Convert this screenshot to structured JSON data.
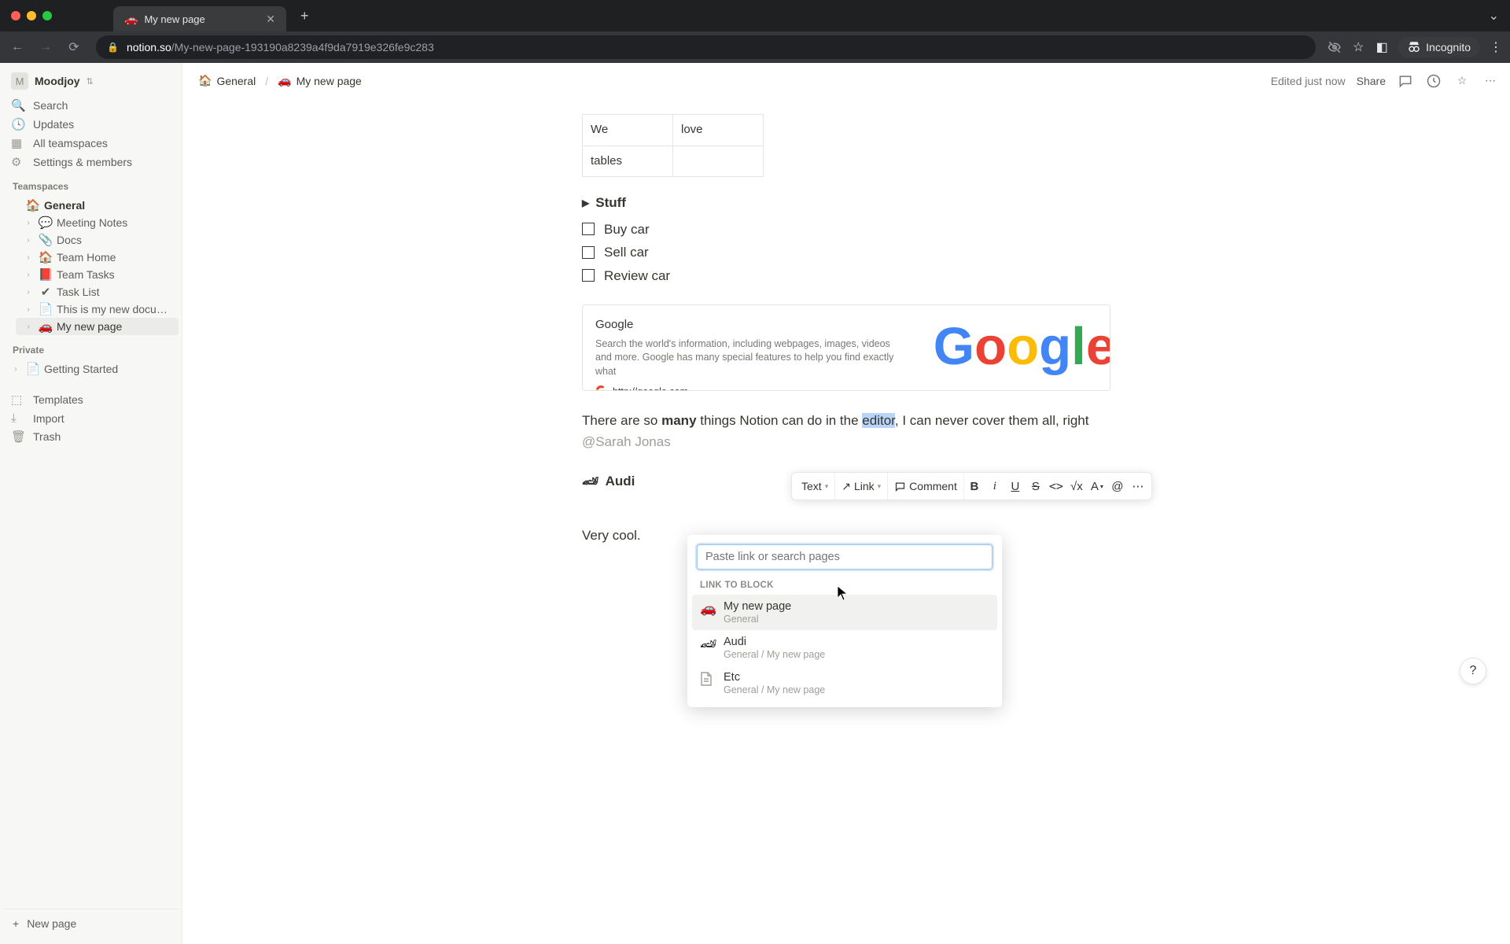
{
  "browser": {
    "tab_title": "My new page",
    "tab_emoji": "🚗",
    "url_domain": "notion.so",
    "url_path": "/My-new-page-193190a8239a4f9da7919e326fe9c283",
    "incognito": "Incognito"
  },
  "workspace": {
    "avatar": "M",
    "name": "Moodjoy"
  },
  "sidebar_top": [
    {
      "icon": "🔍",
      "label": "Search"
    },
    {
      "icon": "🕐",
      "label": "Updates"
    },
    {
      "icon": "▤",
      "label": "All teamspaces"
    },
    {
      "icon": "⚙",
      "label": "Settings & members"
    }
  ],
  "sections": {
    "teamspaces": "Teamspaces",
    "private": "Private"
  },
  "tree": {
    "general": "General",
    "items": [
      {
        "emoji": "💬",
        "label": "Meeting Notes"
      },
      {
        "emoji": "📎",
        "label": "Docs"
      },
      {
        "emoji": "🏠",
        "label": "Team Home"
      },
      {
        "emoji": "📕",
        "label": "Team Tasks"
      },
      {
        "emoji": "✔",
        "label": "Task List"
      },
      {
        "emoji": "📄",
        "label": "This is my new document"
      },
      {
        "emoji": "🚗",
        "label": "My new page"
      }
    ],
    "private_items": [
      {
        "emoji": "📄",
        "label": "Getting Started"
      }
    ]
  },
  "sidebar_bottom": [
    {
      "icon": "⬚",
      "label": "Templates"
    },
    {
      "icon": "⬇",
      "label": "Import"
    },
    {
      "icon": "🗑",
      "label": "Trash"
    }
  ],
  "new_page": "New page",
  "breadcrumb": {
    "root_emoji": "🏠",
    "root": "General",
    "page_emoji": "🚗",
    "page": "My new page"
  },
  "topbar": {
    "edited": "Edited just now",
    "share": "Share"
  },
  "table": {
    "r1c1": "We",
    "r1c2": "love",
    "r2c1": "tables",
    "r2c2": ""
  },
  "toggle": "Stuff",
  "todos": [
    "Buy car",
    "Sell car",
    "Review car"
  ],
  "bookmark": {
    "title": "Google",
    "desc": "Search the world's information, including webpages, images, videos and more. Google has many special features to help you find exactly what",
    "url": "http://google.com"
  },
  "para": {
    "p1": "There are so ",
    "bold": "many",
    "p2": " things Notion can do in the ",
    "sel": "editor",
    "p3": ", I can never cover them all, right ",
    "mention": "@Sarah Jonas"
  },
  "subpage": {
    "emoji": "🏎",
    "label": "Audi"
  },
  "verycool": "Very cool.",
  "toolbar": {
    "text": "Text",
    "link": "Link",
    "comment": "Comment"
  },
  "link_popup": {
    "placeholder": "Paste link or search pages",
    "section": "LINK TO BLOCK",
    "results": [
      {
        "emoji": "🚗",
        "title": "My new page",
        "sub": "General"
      },
      {
        "emoji": "🏎",
        "title": "Audi",
        "sub": "General / My new page"
      },
      {
        "emoji": "doc",
        "title": "Etc",
        "sub": "General / My new page"
      }
    ]
  },
  "help": "?"
}
